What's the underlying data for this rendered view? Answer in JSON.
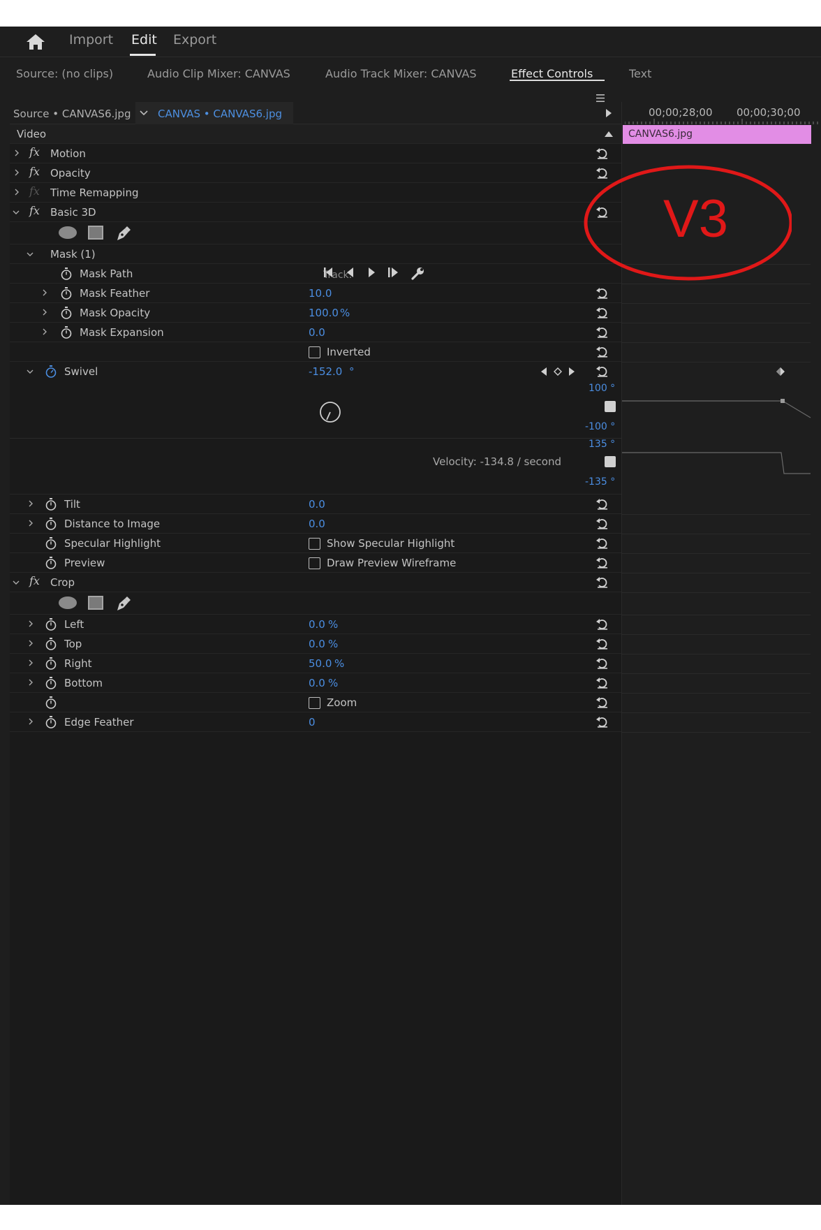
{
  "workspace": {
    "items": [
      {
        "label": "Import",
        "active": false
      },
      {
        "label": "Edit",
        "active": true
      },
      {
        "label": "Export",
        "active": false
      }
    ]
  },
  "panel_tabs": {
    "source": "Source: (no clips)",
    "audio_clip_mixer": "Audio Clip Mixer: CANVAS",
    "audio_track_mixer": "Audio Track Mixer: CANVAS",
    "effect_controls": "Effect Controls",
    "text": "Text"
  },
  "effect_controls": {
    "source_label": "Source • CANVAS6.jpg",
    "clip_label": "CANVAS • CANVAS6.jpg",
    "video_header": "Video",
    "motion": "Motion",
    "opacity": "Opacity",
    "time_remapping": "Time Remapping",
    "basic3d": "Basic 3D",
    "mask": "Mask (1)",
    "mask_path": "Mask Path",
    "track_label": "Track:",
    "mask_feather": {
      "label": "Mask Feather",
      "value": "10.0"
    },
    "mask_opacity": {
      "label": "Mask Opacity",
      "value": "100.0",
      "unit": "%"
    },
    "mask_expansion": {
      "label": "Mask Expansion",
      "value": "0.0"
    },
    "inverted": "Inverted",
    "swivel": {
      "label": "Swivel",
      "value": "-152.0",
      "unit": "°"
    },
    "graph": {
      "top_max": "100 °",
      "top_min": "-100 °",
      "bottom_max": "135 °",
      "bottom_min": "-135 °",
      "velocity": "Velocity: -134.8 / second"
    },
    "tilt": {
      "label": "Tilt",
      "value": "0.0"
    },
    "distance": {
      "label": "Distance to Image",
      "value": "0.0"
    },
    "specular": {
      "label": "Specular Highlight",
      "checkbox": "Show Specular Highlight"
    },
    "preview": {
      "label": "Preview",
      "checkbox": "Draw Preview Wireframe"
    },
    "crop": "Crop",
    "left": {
      "label": "Left",
      "value": "0.0",
      "unit": "%"
    },
    "top": {
      "label": "Top",
      "value": "0.0",
      "unit": "%"
    },
    "right": {
      "label": "Right",
      "value": "50.0",
      "unit": "%"
    },
    "bottom": {
      "label": "Bottom",
      "value": "0.0",
      "unit": "%"
    },
    "zoom": "Zoom",
    "edge_feather": {
      "label": "Edge Feather",
      "value": "0"
    }
  },
  "timeline": {
    "time1": "00;00;28;00",
    "time2": "00;00;30;00",
    "clip_name": "CANVAS6.jpg"
  },
  "annotation": {
    "text": "V3",
    "color": "#e01818"
  },
  "colors": {
    "value_blue": "#4b8ee2",
    "clip_pink": "#e28de5",
    "panel_bg": "#1a1a1a"
  }
}
